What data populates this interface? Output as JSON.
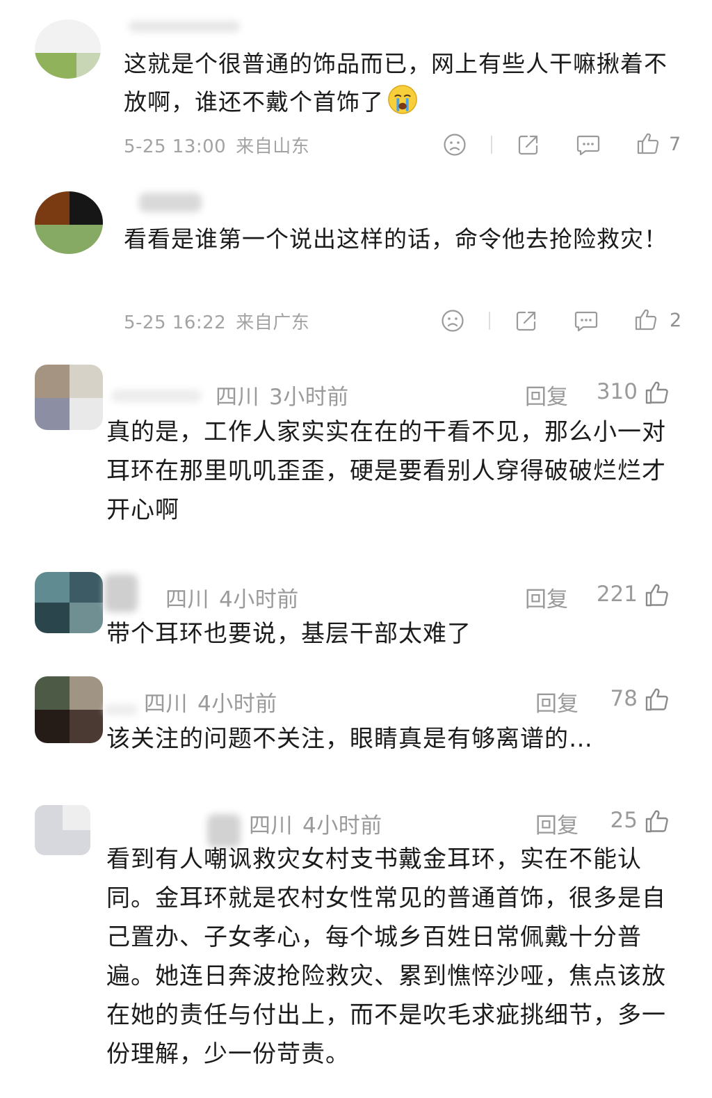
{
  "comments_weibo": [
    {
      "text": "这就是个很普通的饰品而已，网上有些人干嘛揪着不放啊，谁还不戴个首饰了",
      "emoji": "crying-face-icon",
      "date": "5-25 13:00",
      "location": "来自山东",
      "likes": "7"
    },
    {
      "text": "看看是谁第一个说出这样的话，命令他去抢险救灾！",
      "date": "5-25 16:22",
      "location": "来自广东",
      "likes": "2"
    }
  ],
  "comments_douyin": [
    {
      "location": "四川",
      "time": "3小时前",
      "reply_label": "回复",
      "likes": "310",
      "text": "真的是，工作人家实实在在的干看不见，那么小一对耳环在那里叽叽歪歪，硬是要看别人穿得破破烂烂才开心啊"
    },
    {
      "location": "四川",
      "time": "4小时前",
      "reply_label": "回复",
      "likes": "221",
      "text": "带个耳环也要说，基层干部太难了"
    },
    {
      "location": "四川",
      "time": "4小时前",
      "reply_label": "回复",
      "likes": "78",
      "text": "该关注的问题不关注，眼睛真是有够离谱的…"
    },
    {
      "location": "四川",
      "time": "4小时前",
      "reply_label": "回复",
      "likes": "25",
      "text": "看到有人嘲讽救灾女村支书戴金耳环，实在不能认同。金耳环就是农村女性常见的普通首饰，很多是自己置办、子女孝心，每个城乡百姓日常佩戴十分普遍。她连日奔波抢险救灾、累到憔悴沙哑，焦点该放在她的责任与付出上，而不是吹毛求疵挑细节，多一份理解，少一份苛责。"
    }
  ],
  "icons": {
    "dislike": "frown-face-icon",
    "share": "share-icon",
    "comment": "comment-icon",
    "like": "thumbs-up-icon"
  },
  "colors": {
    "text": "#1b1b1b",
    "meta": "#a3a3a3",
    "icon": "#9a9a9a"
  }
}
